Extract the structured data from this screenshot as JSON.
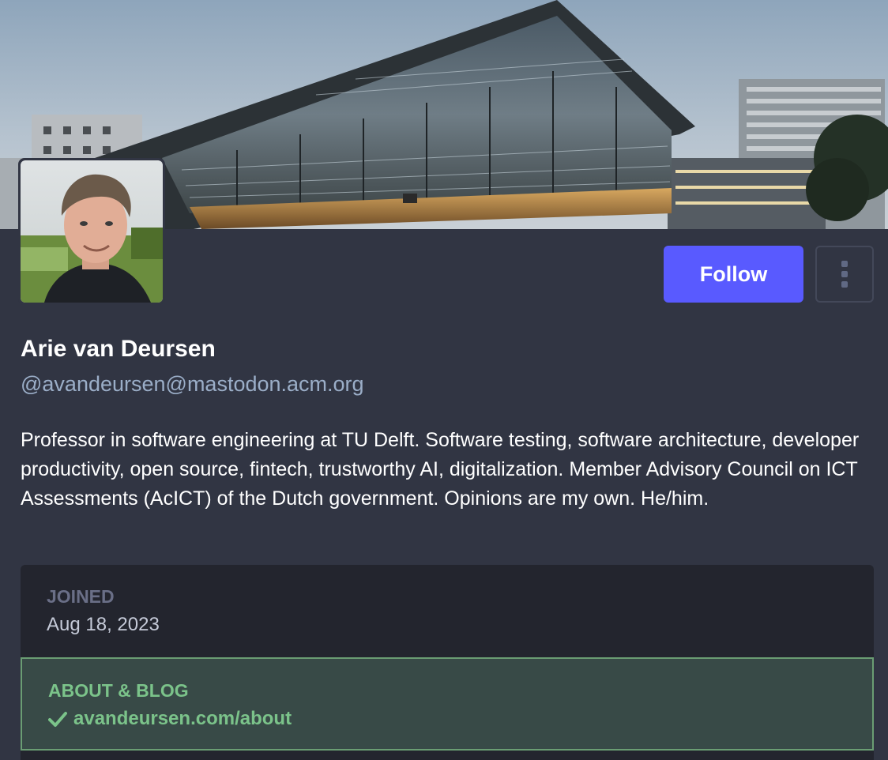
{
  "profile": {
    "display_name": "Arie van Deursen",
    "handle": "@avandeursen@mastodon.acm.org",
    "bio": "Professor in software engineering at TU Delft. Software testing, software architecture, developer productivity, open source, fintech, trustworthy AI, digitalization. Member Advisory Council on ICT Assessments (AcICT) of the Dutch government. Opinions are my own. He/him."
  },
  "actions": {
    "follow_label": "Follow",
    "more_icon": "more-vertical-icon"
  },
  "fields": [
    {
      "label": "JOINED",
      "value": "Aug 18, 2023",
      "verified": false
    },
    {
      "label": "ABOUT & BLOG",
      "value": "avandeursen.com/about",
      "verified": true,
      "icon": "check-icon"
    }
  ],
  "colors": {
    "background": "#313543",
    "accent": "#595aff",
    "handle": "#9baec8",
    "verified": "#7bc38a",
    "verified_bg": "#384a47"
  }
}
